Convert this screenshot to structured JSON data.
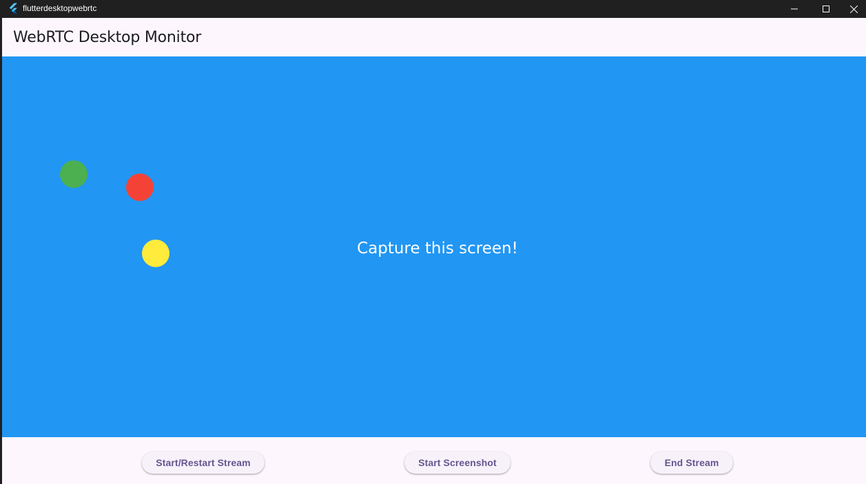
{
  "window": {
    "title": "flutterdesktopwebrtc",
    "icon": "flutter-logo-icon",
    "controls": [
      "minimize-icon",
      "maximize-icon",
      "close-icon"
    ]
  },
  "appbar": {
    "title": "WebRTC Desktop Monitor"
  },
  "capture_area": {
    "background": "#2196f3",
    "message": "Capture this screen!",
    "dots": [
      {
        "name": "green-dot",
        "color": "#4caf50"
      },
      {
        "name": "red-dot",
        "color": "#f44336"
      },
      {
        "name": "yellow-dot",
        "color": "#ffeb3b"
      }
    ]
  },
  "actions": {
    "start_stream": "Start/Restart Stream",
    "start_screenshot": "Start Screenshot",
    "end_stream": "End Stream"
  },
  "colors": {
    "surface": "#fdf7fd",
    "button_text": "#65558f",
    "title_bar": "#202020"
  }
}
